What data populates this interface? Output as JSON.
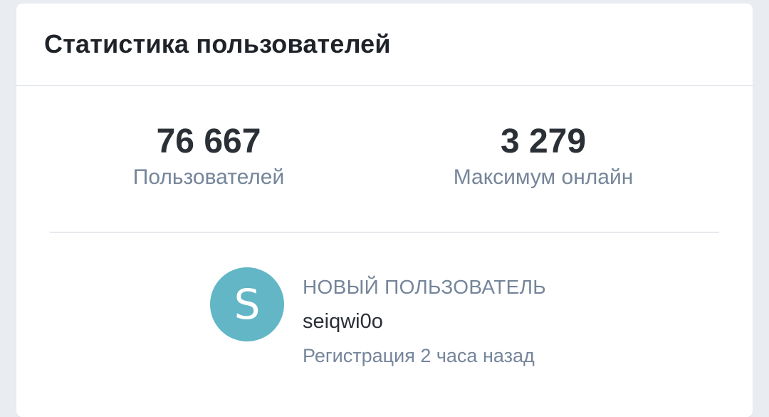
{
  "card": {
    "title": "Статистика пользователей"
  },
  "stats": {
    "users": {
      "value": "76 667",
      "label": "Пользователей"
    },
    "max_online": {
      "value": "3 279",
      "label": "Максимум онлайн"
    }
  },
  "new_user": {
    "caption": "НОВЫЙ ПОЛЬЗОВАТЕЛЬ",
    "avatar_letter": "S",
    "avatar_color": "#62b6c5",
    "username": "seiqwi0o",
    "registered": "Регистрация 2 часа назад"
  }
}
